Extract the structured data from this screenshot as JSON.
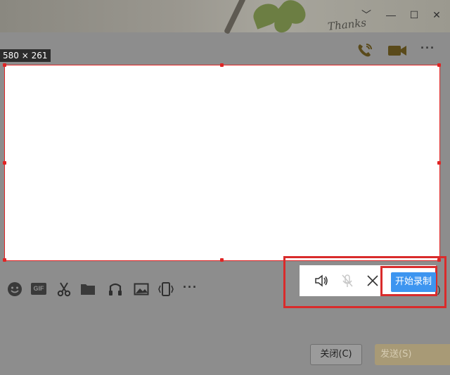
{
  "window": {
    "banner_text": "Thanks",
    "controls": {
      "collapse": "﹀",
      "minimize": "—",
      "maximize": "☐",
      "close": "✕"
    },
    "top_actions": {
      "more_label": "···"
    }
  },
  "capture": {
    "size_label": "580 × 261"
  },
  "toolbar": {
    "gif_label": "GIF",
    "more_label": "···"
  },
  "recorder": {
    "start_label": "开始录制",
    "accent_color": "#3d95f0",
    "highlight_color": "#d92b2b"
  },
  "footer": {
    "close_label": "关闭(C)",
    "send_label": "发送(S)"
  }
}
